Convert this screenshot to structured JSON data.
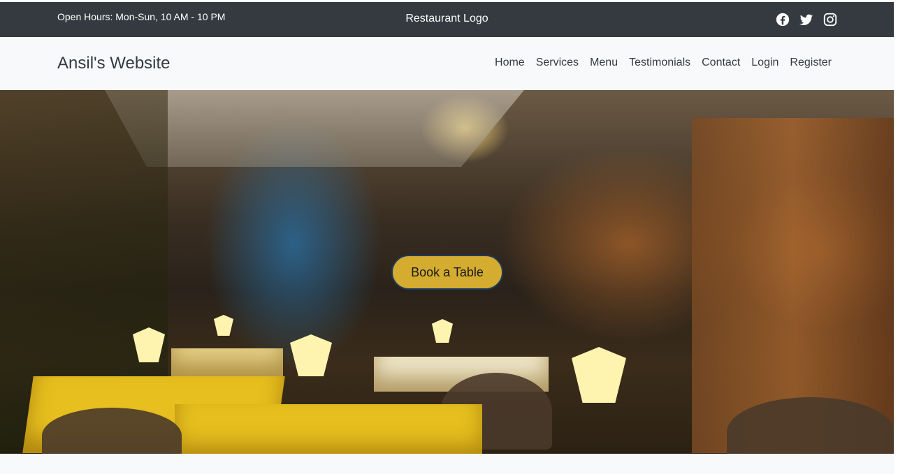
{
  "topbar": {
    "hours": "Open Hours: Mon-Sun, 10 AM - 10 PM",
    "logo": "Restaurant Logo",
    "social": [
      {
        "name": "facebook-icon"
      },
      {
        "name": "twitter-icon"
      },
      {
        "name": "instagram-icon"
      }
    ]
  },
  "navbar": {
    "brand": "Ansil's Website",
    "links": [
      "Home",
      "Services",
      "Menu",
      "Testimonials",
      "Contact",
      "Login",
      "Register"
    ]
  },
  "hero": {
    "cta": "Book a Table"
  },
  "colors": {
    "topbar_bg": "#343a40",
    "navbar_bg": "#f8f9fa",
    "cta_bg": "#d4ac30",
    "cta_border": "#1f3a5f"
  }
}
